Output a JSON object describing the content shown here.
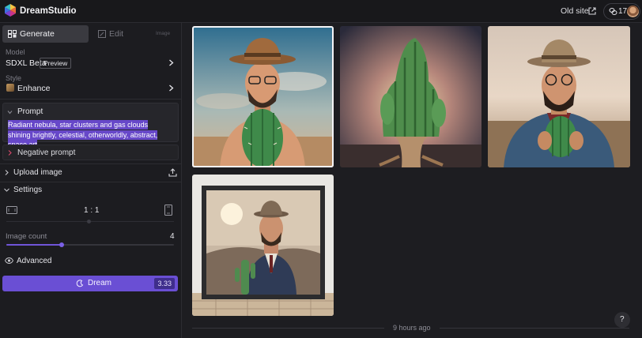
{
  "app": {
    "brand": "DreamStudio"
  },
  "topbar": {
    "old_site": "Old site",
    "credits": "17"
  },
  "tabs": {
    "generate": "Generate",
    "edit": "Edit",
    "edit_badge": "Image"
  },
  "model": {
    "label": "Model",
    "value": "SDXL Beta",
    "badge": "Preview"
  },
  "style": {
    "label": "Style",
    "value": "Enhance"
  },
  "prompt": {
    "title": "Prompt",
    "text": "Radiant nebula, star clusters and gas clouds shining brightly, celestial, otherworldly, abstract, space art"
  },
  "negative_prompt": {
    "title": "Negative prompt"
  },
  "upload": {
    "label": "Upload image"
  },
  "settings": {
    "label": "Settings"
  },
  "aspect": {
    "value": "1 : 1"
  },
  "image_count": {
    "label": "Image count",
    "value": "4",
    "fraction": 0.33
  },
  "advanced": {
    "label": "Advanced"
  },
  "dream": {
    "label": "Dream",
    "cost": "3.33"
  },
  "gallery": {
    "timestamp": "9 hours ago",
    "help": "?"
  },
  "colors": {
    "accent": "#6a4fd4",
    "highlight": "#6748c9",
    "background": "#1e1e22"
  },
  "icons": [
    "dreamstudio-logo-icon",
    "external-link-icon",
    "credits-icon",
    "avatar",
    "generate-icon",
    "edit-icon",
    "chevron-right-icon",
    "chevron-down-icon",
    "upload-icon",
    "aspect-landscape-icon",
    "aspect-portrait-icon",
    "eye-icon",
    "dream-icon",
    "help-icon"
  ]
}
